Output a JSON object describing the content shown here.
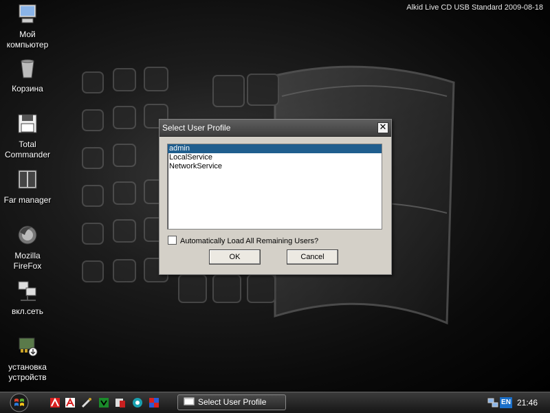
{
  "desktop": {
    "version_text": "Alkid Live CD USB Standard 2009-08-18",
    "icons": [
      {
        "line1": "Мой",
        "line2": "компьютер",
        "icon": "my-computer-icon"
      },
      {
        "line1": "Корзина",
        "line2": "",
        "icon": "recycle-bin-icon"
      },
      {
        "line1": "Total",
        "line2": "Commander",
        "icon": "total-commander-icon"
      },
      {
        "line1": "Far manager",
        "line2": "",
        "icon": "far-manager-icon"
      },
      {
        "line1": "Mozilla",
        "line2": "FireFox",
        "icon": "firefox-icon"
      },
      {
        "line1": "вкл.сеть",
        "line2": "",
        "icon": "network-icon"
      },
      {
        "line1": "установка",
        "line2": "устройств",
        "icon": "device-install-icon"
      }
    ]
  },
  "dialog": {
    "title": "Select User Profile",
    "close_label": "✕",
    "profiles": [
      "admin",
      "LocalService",
      "NetworkService"
    ],
    "selected_profile": "admin",
    "checkbox_label": "Automatically Load All Remaining Users?",
    "checkbox_checked": false,
    "ok_label": "OK",
    "cancel_label": "Cancel"
  },
  "taskbar": {
    "quick_launch": [
      "antivirus-icon",
      "avira-icon",
      "tool-icon",
      "green-app-icon",
      "red-app-icon",
      "teal-app-icon",
      "puzzle-icon"
    ],
    "task_button_label": "Select User Profile",
    "language": "EN",
    "clock": "21:46"
  },
  "colors": {
    "selection": "#1f5e8e",
    "dialog_bg": "#d4d0c8",
    "taskbar_top": "#3b3b3b"
  }
}
